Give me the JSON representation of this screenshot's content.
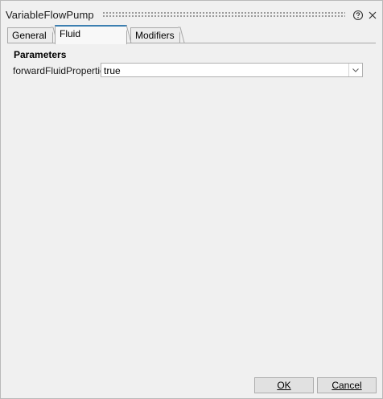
{
  "window": {
    "title": "VariableFlowPump"
  },
  "titlebar": {
    "help_icon": "help-circle-icon",
    "close_icon": "close-icon"
  },
  "tabs": [
    {
      "label": "General",
      "selected": false
    },
    {
      "label": "Fluid Properties",
      "selected": true
    },
    {
      "label": "Modifiers",
      "selected": false
    }
  ],
  "content": {
    "section_title": "Parameters",
    "properties": [
      {
        "name": "forwardFluidProperties",
        "value": "true"
      }
    ]
  },
  "buttons": {
    "ok_label": "OK",
    "cancel_label": "Cancel"
  },
  "colors": {
    "selected_tab_accent": "#3c7fb1",
    "background": "#f0f0f0"
  }
}
